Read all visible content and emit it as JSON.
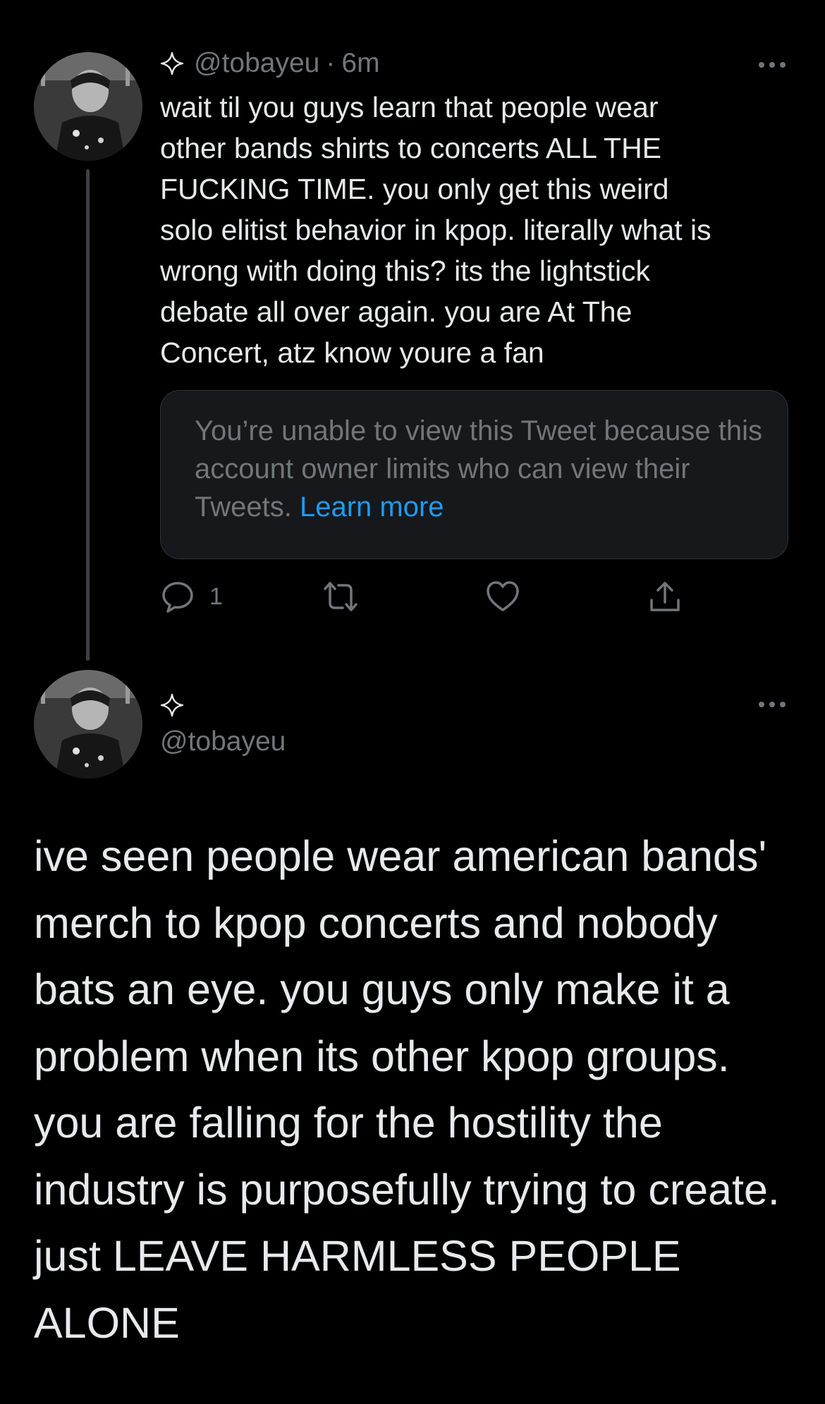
{
  "tweet1": {
    "handle": "@tobayeu",
    "separator": "·",
    "time": "6m",
    "text": "wait til you guys learn that people wear\nother bands shirts to concerts ALL THE\nFUCKING TIME. you only get this weird\nsolo elitist behavior in kpop. literally what is\nwrong with doing this? its the lightstick\ndebate all over again. you are At The\nConcert, atz know youre a fan",
    "quote": {
      "text": "You’re unable to view this Tweet because this account owner limits who can view their Tweets.",
      "link_label": "Learn more"
    },
    "actions": {
      "reply_count": "1",
      "retweet_count": "",
      "like_count": ""
    }
  },
  "tweet2": {
    "handle": "@tobayeu",
    "text": "ive seen people wear american bands' merch to kpop concerts and nobody bats an eye. you guys only make it a problem when its other kpop groups. you are falling for the hostility the industry is purposefully trying to create. just LEAVE HARMLESS PEOPLE ALONE"
  },
  "icons": {
    "sparkle": "sparkle-icon",
    "more": "more-dots-icon",
    "reply": "reply-icon",
    "retweet": "retweet-icon",
    "like": "heart-icon",
    "share": "share-icon"
  },
  "colors": {
    "background": "#000000",
    "text": "#e7e9ea",
    "secondary": "#71767b",
    "link": "#1d9bf0",
    "quote_bg": "#16181c",
    "border": "#2f3336"
  }
}
